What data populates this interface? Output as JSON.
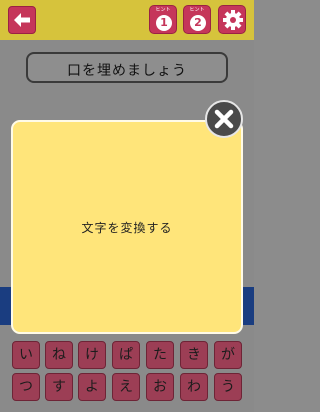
{
  "header": {
    "hint1": {
      "label": "ヒント",
      "number": "1"
    },
    "hint2": {
      "label": "ヒント",
      "number": "2"
    }
  },
  "question": "口を埋めましょう",
  "keyboard": {
    "row1": [
      "い",
      "ね",
      "け",
      "ぱ",
      "た",
      "き",
      "が"
    ],
    "row2": [
      "つ",
      "す",
      "よ",
      "え",
      "お",
      "わ",
      "う"
    ]
  },
  "modal": {
    "message": "文字を変換する"
  },
  "colors": {
    "topbar": "#d6c33c",
    "button": "#c5365a",
    "modal": "#ffe57a",
    "band": "#1a3d80"
  },
  "icons": {
    "back": "left-arrow-icon",
    "settings": "gear-icon",
    "close": "close-icon"
  }
}
